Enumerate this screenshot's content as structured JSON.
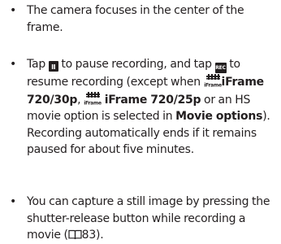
{
  "bullets": [
    {
      "marker": "•",
      "text": "The camera focuses in the center of the frame."
    },
    {
      "marker": "•",
      "tap_1": "Tap ",
      "pause_icon_glyph": "II",
      "to_pause": " to pause recording, and tap ",
      "record_icon_glyph": "REC",
      "to_resume": " to resume recording (except when ",
      "iframe_icon_label": "iFrame",
      "option_1": "iFrame 720/30p",
      "comma": ", ",
      "option_2": "iFrame 720/25p",
      "or_hs": " or an HS movie option is selected in ",
      "menu_name": "Movie options",
      "closing": "). Recording automatically ends if it remains paused for about five minutes."
    },
    {
      "marker": "•",
      "text_before": "You can capture a still image by pressing the shutter-release button while recording a movie (",
      "page_ref": "83",
      "text_after": ")."
    }
  ],
  "icons": {
    "pause_button": "pause-icon",
    "record_button": "record-icon",
    "iframe": "iframe-icon",
    "book": "book-reference-icon"
  },
  "colors": {
    "text": "#231f20",
    "icon_bg": "#231f20",
    "icon_fg": "#ffffff"
  }
}
